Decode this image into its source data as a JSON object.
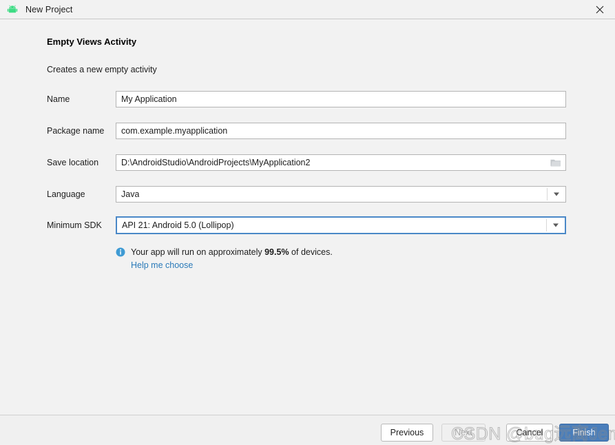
{
  "window": {
    "title": "New Project",
    "app_icon": "android-robot-icon",
    "close_icon": "close-icon",
    "accent_green": "#3ddc84"
  },
  "template": {
    "heading": "Empty Views Activity",
    "description": "Creates a new empty activity"
  },
  "form": {
    "fields": [
      {
        "label": "Name",
        "value": "My Application",
        "type": "text"
      },
      {
        "label": "Package name",
        "value": "com.example.myapplication",
        "type": "text"
      },
      {
        "label": "Save location",
        "value": "D:\\AndroidStudio\\AndroidProjects\\MyApplication2",
        "type": "path",
        "icon": "folder-icon"
      },
      {
        "label": "Language",
        "value": "Java",
        "type": "dropdown",
        "icon": "chevron-down-icon"
      },
      {
        "label": "Minimum SDK",
        "value": "API 21: Android 5.0 (Lollipop)",
        "type": "dropdown",
        "icon": "chevron-down-icon",
        "focused": true
      }
    ]
  },
  "info": {
    "icon": "info-icon",
    "text_before": "Your app will run on approximately",
    "percent": "99.5%",
    "text_after": "of devices.",
    "link": "Help me choose",
    "link_color": "#2a7ab9"
  },
  "footer": {
    "buttons": [
      {
        "label": "Previous",
        "state": "enabled"
      },
      {
        "label": "Next",
        "state": "disabled"
      },
      {
        "label": "Cancel",
        "state": "enabled"
      },
      {
        "label": "Finish",
        "state": "primary"
      }
    ],
    "primary_color": "#4a7ebb"
  },
  "watermark": {
    "text": "CSDN @bug远离Jemma"
  }
}
